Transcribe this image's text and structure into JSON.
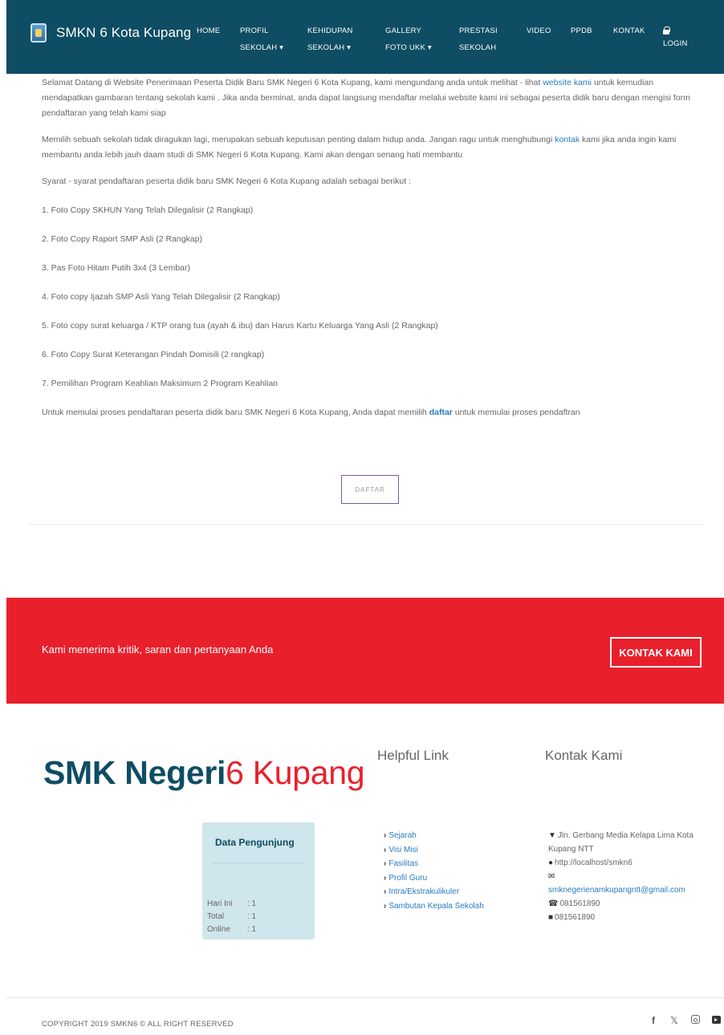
{
  "navbar": {
    "brand": "SMKN 6 Kota Kupang",
    "items": [
      {
        "line1": "HOME",
        "line2": ""
      },
      {
        "line1": "PROFIL",
        "line2": "SEKOLAH ▾"
      },
      {
        "line1": "KEHIDUPAN",
        "line2": "SEKOLAH ▾"
      },
      {
        "line1": "GALLERY",
        "line2": "FOTO UKK ▾"
      },
      {
        "line1": "PRESTASI",
        "line2": "SEKOLAH"
      },
      {
        "line1": "VIDEO",
        "line2": ""
      },
      {
        "line1": "PPDB",
        "line2": ""
      },
      {
        "line1": "KONTAK",
        "line2": ""
      }
    ],
    "login": "LOGIN"
  },
  "content": {
    "intro_a": "Selamat Datang di Website Penerimaan Peserta Didik Baru SMK Negeri 6 Kota Kupang, kami mengundang anda untuk melihat - lihat ",
    "intro_link": "website kami",
    "intro_b": " untuk kemudian mendapatkan gambaran tentang sekolah kami . Jika anda berminat, anda dapat langsung mendaftar melalui website kami ini sebagai peserta didik baru dengan mengisi form pendaftaran yang telah kami siap",
    "para2_a": "Memilih sebuah sekolah tidak diragukan lagi, merupakan sebuah keputusan penting dalam hidup anda. Jangan ragu untuk menghubungi ",
    "para2_link": "kontak",
    "para2_b": " kami jika anda ingin kami membantu anda lebih jauh daam studi di SMK Negeri 6 Kota Kupang. Kami akan dengan senang hati membantu",
    "syarat": "Syarat - syarat pendaftaran peserta didik baru SMK Negeri 6 Kota Kupang adalah sebagai berikut :",
    "requirements": [
      "1. Foto Copy SKHUN Yang Telah Dilegalisir (2 Rangkap)",
      "2. Foto Copy Raport SMP Asli (2 Rangkap)",
      "3. Pas Foto Hitam Putih 3x4 (3 Lembar)",
      "4. Foto copy Ijazah SMP Asli Yang Telah Dilegalisir (2 Rangkap)",
      "5. Foto copy surat keluarga / KTP orang tua (ayah & ibu) dan Harus Kartu Keluarga Yang Asli (2 Rangkap)",
      "6. Foto Copy Surat Keterangan Pindah Domisili (2 rangkap)",
      "7. Pemilihan Program Keahlian Maksimum 2 Program Keahlian"
    ],
    "closing_a": "Untuk memulai proses pendaftaran peserta didik baru SMK Negeri 6 Kota Kupang, Anda dapat memilih ",
    "closing_link": "daftar",
    "closing_b": " untuk memulai proses pendaftran",
    "daftar_button": "DAFTAR"
  },
  "cta": {
    "text": "Kami menerima kritik, saran dan pertanyaan Anda",
    "button": "KONTAK KAMI"
  },
  "footer": {
    "logo_bold": "SMK Negeri",
    "logo_light": "6 Kupang",
    "helpful_title": "Helpful Link",
    "contact_title": "Kontak Kami",
    "visitors": {
      "title": "Data Pengunjung",
      "rows": [
        {
          "label": "Hari Ini",
          "value": ": 1"
        },
        {
          "label": "Total",
          "value": ": 1"
        },
        {
          "label": "Online",
          "value": ": 1"
        }
      ]
    },
    "links": [
      "Sejarah",
      "Visi Misi",
      "Fasilitas",
      "Profil Guru",
      "Intra/Ekstrakulikuler",
      "Sambutan Kepala Sekolah"
    ],
    "contact": {
      "address": "Jln. Gerbang Media Kelapa Lima Kota Kupang NTT",
      "website": "http://localhost/smkn6",
      "email": "smknegerienamkupangntt@gmail.com",
      "phone": "081561890",
      "fax": "081561890"
    },
    "copyright": "COPYRIGHT 2019 SMKN6 © ALL RIGHT RESERVED"
  },
  "icons": {
    "map_marker": "map-marker-icon",
    "globe": "globe-icon",
    "envelope": "envelope-icon",
    "phone": "phone-icon",
    "fax": "fax-icon",
    "facebook": "facebook-icon",
    "twitter": "twitter-icon",
    "instagram": "instagram-icon",
    "youtube": "youtube-icon"
  },
  "colors": {
    "navbar": "#0e4d63",
    "accent_red": "#e8202c",
    "link": "#2a7abf",
    "visitor_box": "#cfe6ec"
  }
}
